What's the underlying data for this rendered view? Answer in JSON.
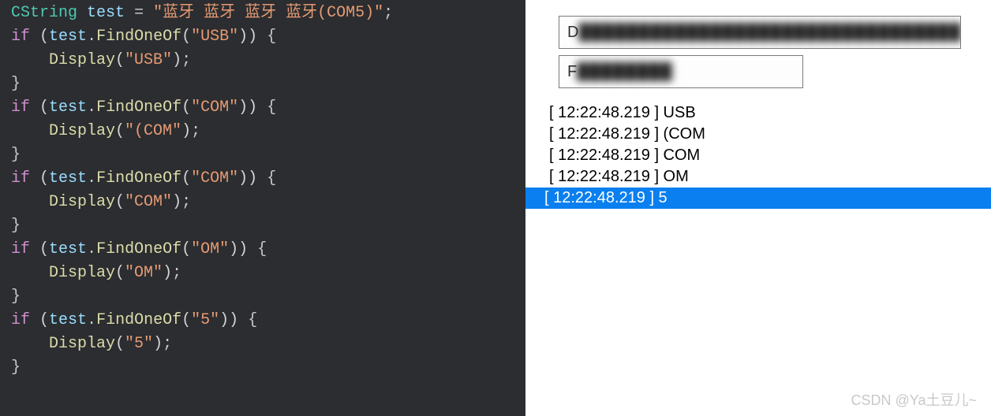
{
  "code": {
    "tokens": [
      [
        {
          "t": "type",
          "v": "CString"
        },
        {
          "t": "sp",
          "v": " "
        },
        {
          "t": "var",
          "v": "test"
        },
        {
          "t": "sp",
          "v": " "
        },
        {
          "t": "op",
          "v": "="
        },
        {
          "t": "sp",
          "v": " "
        },
        {
          "t": "str",
          "v": "\"蓝牙 蓝牙 蓝牙 蓝牙(COM5)\""
        },
        {
          "t": "punct",
          "v": ";"
        }
      ],
      [
        {
          "t": "kw",
          "v": "if"
        },
        {
          "t": "sp",
          "v": " "
        },
        {
          "t": "paren",
          "v": "("
        },
        {
          "t": "var",
          "v": "test"
        },
        {
          "t": "punct",
          "v": "."
        },
        {
          "t": "func",
          "v": "FindOneOf"
        },
        {
          "t": "paren",
          "v": "("
        },
        {
          "t": "str",
          "v": "\"USB\""
        },
        {
          "t": "paren",
          "v": ")"
        },
        {
          "t": "paren",
          "v": ")"
        },
        {
          "t": "sp",
          "v": " "
        },
        {
          "t": "punct",
          "v": "{"
        }
      ],
      [
        {
          "t": "guide",
          "v": ""
        },
        {
          "t": "sp",
          "v": "    "
        },
        {
          "t": "func",
          "v": "Display"
        },
        {
          "t": "paren",
          "v": "("
        },
        {
          "t": "str",
          "v": "\"USB\""
        },
        {
          "t": "paren",
          "v": ")"
        },
        {
          "t": "punct",
          "v": ";"
        }
      ],
      [
        {
          "t": "punct",
          "v": "}"
        }
      ],
      [
        {
          "t": "kw",
          "v": "if"
        },
        {
          "t": "sp",
          "v": " "
        },
        {
          "t": "paren",
          "v": "("
        },
        {
          "t": "var",
          "v": "test"
        },
        {
          "t": "punct",
          "v": "."
        },
        {
          "t": "func",
          "v": "FindOneOf"
        },
        {
          "t": "paren",
          "v": "("
        },
        {
          "t": "str",
          "v": "\"COM\""
        },
        {
          "t": "paren",
          "v": ")"
        },
        {
          "t": "paren",
          "v": ")"
        },
        {
          "t": "sp",
          "v": " "
        },
        {
          "t": "punct",
          "v": "{"
        }
      ],
      [
        {
          "t": "guide",
          "v": ""
        },
        {
          "t": "sp",
          "v": "    "
        },
        {
          "t": "func",
          "v": "Display"
        },
        {
          "t": "paren",
          "v": "("
        },
        {
          "t": "str",
          "v": "\"(COM\""
        },
        {
          "t": "paren",
          "v": ")"
        },
        {
          "t": "punct",
          "v": ";"
        }
      ],
      [
        {
          "t": "punct",
          "v": "}"
        }
      ],
      [
        {
          "t": "kw",
          "v": "if"
        },
        {
          "t": "sp",
          "v": " "
        },
        {
          "t": "paren",
          "v": "("
        },
        {
          "t": "var",
          "v": "test"
        },
        {
          "t": "punct",
          "v": "."
        },
        {
          "t": "func",
          "v": "FindOneOf"
        },
        {
          "t": "paren",
          "v": "("
        },
        {
          "t": "str",
          "v": "\"COM\""
        },
        {
          "t": "paren",
          "v": ")"
        },
        {
          "t": "paren",
          "v": ")"
        },
        {
          "t": "sp",
          "v": " "
        },
        {
          "t": "punct",
          "v": "{"
        }
      ],
      [
        {
          "t": "guide",
          "v": ""
        },
        {
          "t": "sp",
          "v": "    "
        },
        {
          "t": "func",
          "v": "Display"
        },
        {
          "t": "paren",
          "v": "("
        },
        {
          "t": "str",
          "v": "\"COM\""
        },
        {
          "t": "paren",
          "v": ")"
        },
        {
          "t": "punct",
          "v": ";"
        }
      ],
      [
        {
          "t": "punct",
          "v": "}"
        }
      ],
      [
        {
          "t": "kw",
          "v": "if"
        },
        {
          "t": "sp",
          "v": " "
        },
        {
          "t": "paren",
          "v": "("
        },
        {
          "t": "var",
          "v": "test"
        },
        {
          "t": "punct",
          "v": "."
        },
        {
          "t": "func",
          "v": "FindOneOf"
        },
        {
          "t": "paren",
          "v": "("
        },
        {
          "t": "str",
          "v": "\"OM\""
        },
        {
          "t": "paren",
          "v": ")"
        },
        {
          "t": "paren",
          "v": ")"
        },
        {
          "t": "sp",
          "v": " "
        },
        {
          "t": "punct",
          "v": "{"
        }
      ],
      [
        {
          "t": "guide",
          "v": ""
        },
        {
          "t": "sp",
          "v": "    "
        },
        {
          "t": "func",
          "v": "Display"
        },
        {
          "t": "paren",
          "v": "("
        },
        {
          "t": "str",
          "v": "\"OM\""
        },
        {
          "t": "paren",
          "v": ")"
        },
        {
          "t": "punct",
          "v": ";"
        }
      ],
      [
        {
          "t": "punct",
          "v": "}"
        }
      ],
      [
        {
          "t": "kw",
          "v": "if"
        },
        {
          "t": "sp",
          "v": " "
        },
        {
          "t": "paren",
          "v": "("
        },
        {
          "t": "var",
          "v": "test"
        },
        {
          "t": "punct",
          "v": "."
        },
        {
          "t": "func",
          "v": "FindOneOf"
        },
        {
          "t": "paren",
          "v": "("
        },
        {
          "t": "str",
          "v": "\"5\""
        },
        {
          "t": "paren",
          "v": ")"
        },
        {
          "t": "paren",
          "v": ")"
        },
        {
          "t": "sp",
          "v": " "
        },
        {
          "t": "punct",
          "v": "{"
        }
      ],
      [
        {
          "t": "guide",
          "v": ""
        },
        {
          "t": "sp",
          "v": "    "
        },
        {
          "t": "func",
          "v": "Display"
        },
        {
          "t": "paren",
          "v": "("
        },
        {
          "t": "str",
          "v": "\"5\""
        },
        {
          "t": "paren",
          "v": ")"
        },
        {
          "t": "punct",
          "v": ";"
        }
      ],
      [
        {
          "t": "punct",
          "v": "}"
        }
      ]
    ]
  },
  "panel": {
    "box1_prefix": "D",
    "box1_blur": "████████████████████████████████",
    "box2_prefix": "F",
    "box2_blur": "████████"
  },
  "logs": [
    {
      "time": "12:22:48.219",
      "msg": "USB",
      "selected": false
    },
    {
      "time": "12:22:48.219",
      "msg": "(COM",
      "selected": false
    },
    {
      "time": "12:22:48.219",
      "msg": "COM",
      "selected": false
    },
    {
      "time": "12:22:48.219",
      "msg": "OM",
      "selected": false
    },
    {
      "time": "12:22:48.219",
      "msg": "5",
      "selected": true
    }
  ],
  "watermark": "CSDN @Ya土豆儿~"
}
